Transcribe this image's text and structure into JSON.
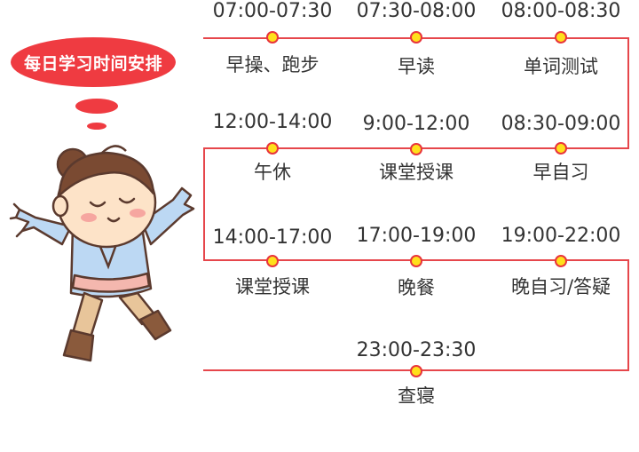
{
  "title": "每日学习时间安排",
  "colors": {
    "accent": "#e6464b",
    "dot_fill": "#ffe01b",
    "text": "#333333",
    "bubble": "#ef3b41"
  },
  "icons": {
    "character": "cartoon-student-character-icon"
  },
  "schedule": {
    "row1": [
      {
        "time": "07:00-07:30",
        "activity": "早操、跑步"
      },
      {
        "time": "07:30-08:00",
        "activity": "早读"
      },
      {
        "time": "08:00-08:30",
        "activity": "单词测试"
      }
    ],
    "row2": [
      {
        "time": "12:00-14:00",
        "activity": "午休"
      },
      {
        "time": "9:00-12:00",
        "activity": "课堂授课"
      },
      {
        "time": "08:30-09:00",
        "activity": "早自习"
      }
    ],
    "row3": [
      {
        "time": "14:00-17:00",
        "activity": "课堂授课"
      },
      {
        "time": "17:00-19:00",
        "activity": "晚餐"
      },
      {
        "time": "19:00-22:00",
        "activity": "晚自习/答疑"
      }
    ],
    "row4": [
      {
        "time": "23:00-23:30",
        "activity": "查寝"
      }
    ]
  }
}
